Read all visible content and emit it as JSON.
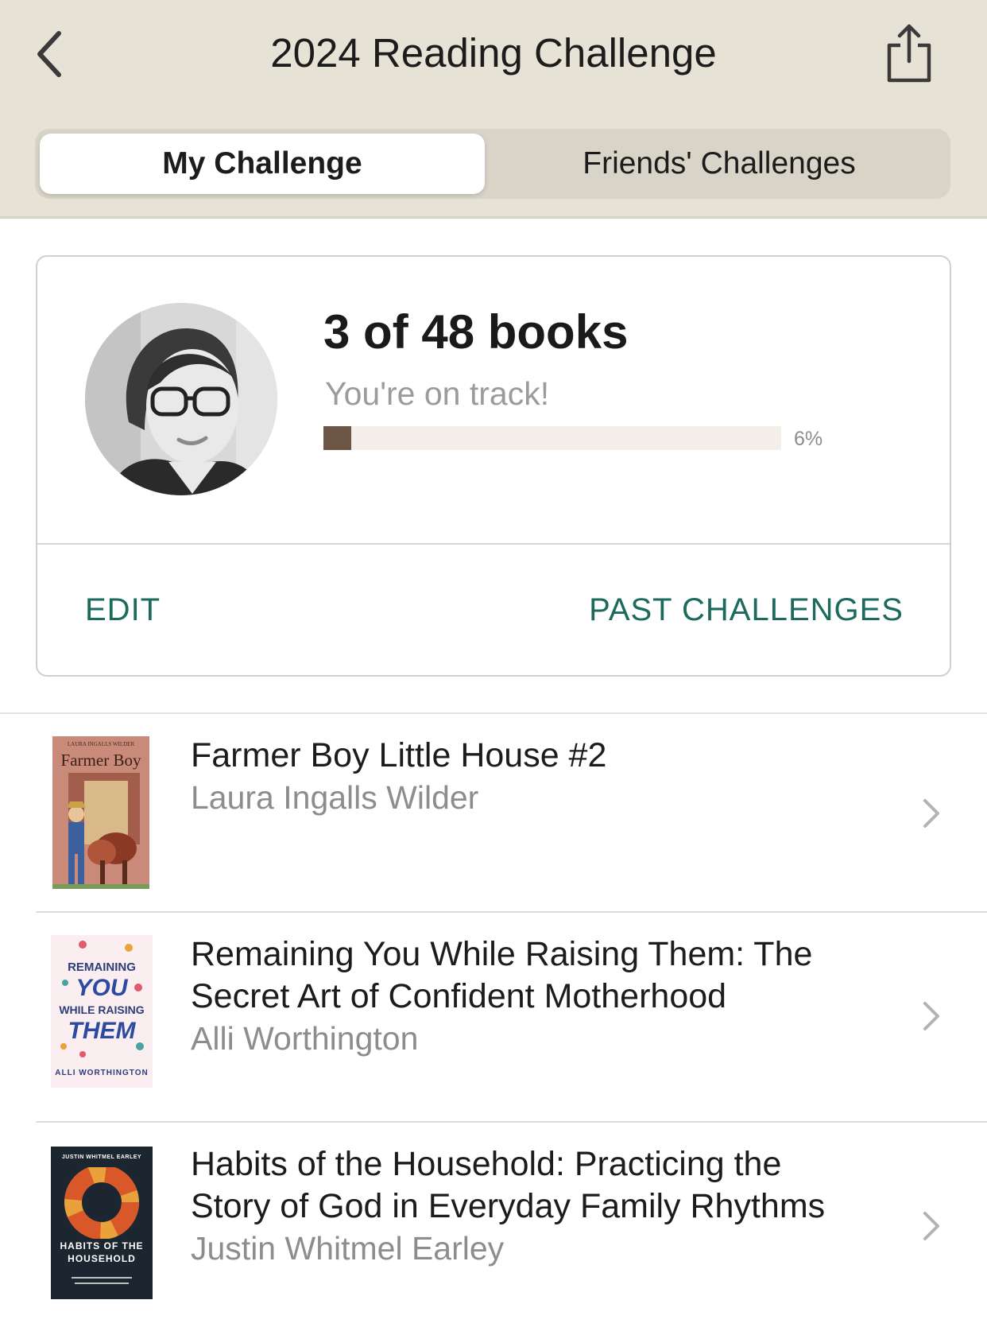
{
  "header": {
    "title": "2024 Reading Challenge",
    "back_icon": "chevron-left-icon",
    "share_icon": "share-icon",
    "background": "#e7e2d6"
  },
  "tabs": [
    {
      "label": "My Challenge",
      "active": true
    },
    {
      "label": "Friends' Challenges",
      "active": false
    }
  ],
  "challenge": {
    "count_text": "3 of 48 books",
    "status": "You're on track!",
    "progress": 0.06,
    "progress_label": "6%",
    "progress_color": "#6e5647",
    "edit_label": "EDIT",
    "past_label": "PAST CHALLENGES",
    "accent": "#1b6a5c"
  },
  "books": [
    {
      "title": "Farmer Boy Little House #2",
      "author": "Laura Ingalls Wilder",
      "cover": {
        "author": "LAURA INGALLS WILDER",
        "title": "Farmer Boy"
      }
    },
    {
      "title": "Remaining You While Raising Them: The Secret Art of Confident Motherhood",
      "author": "Alli Worthington",
      "cover": {
        "line1": "REMAINING",
        "line2": "YOU",
        "line3": "WHILE RAISING",
        "line4": "THEM",
        "author": "ALLI WORTHINGTON"
      }
    },
    {
      "title": "Habits of the Household: Practicing the Story of God in Everyday Family Rhythms",
      "author": "Justin Whitmel Earley",
      "cover": {
        "author": "JUSTIN WHITMEL EARLEY",
        "line1": "HABITS OF THE",
        "line2": "HOUSEHOLD"
      }
    }
  ]
}
